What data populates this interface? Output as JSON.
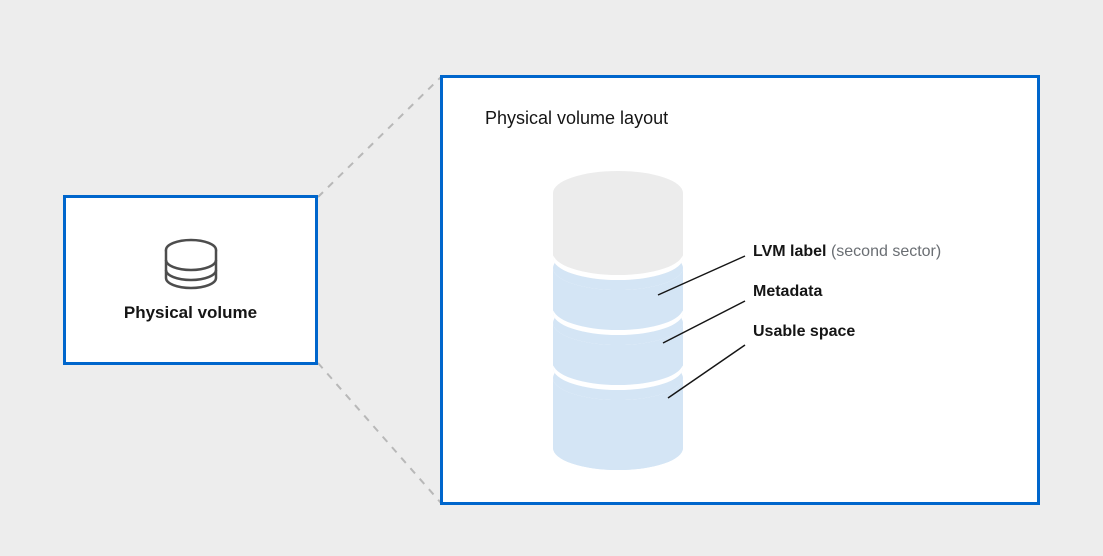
{
  "left": {
    "label": "Physical volume"
  },
  "right": {
    "title": "Physical volume layout",
    "annotations": {
      "label1_bold": "LVM label",
      "label1_rest": " (second sector)",
      "label2": "Metadata",
      "label3": "Usable space"
    }
  }
}
